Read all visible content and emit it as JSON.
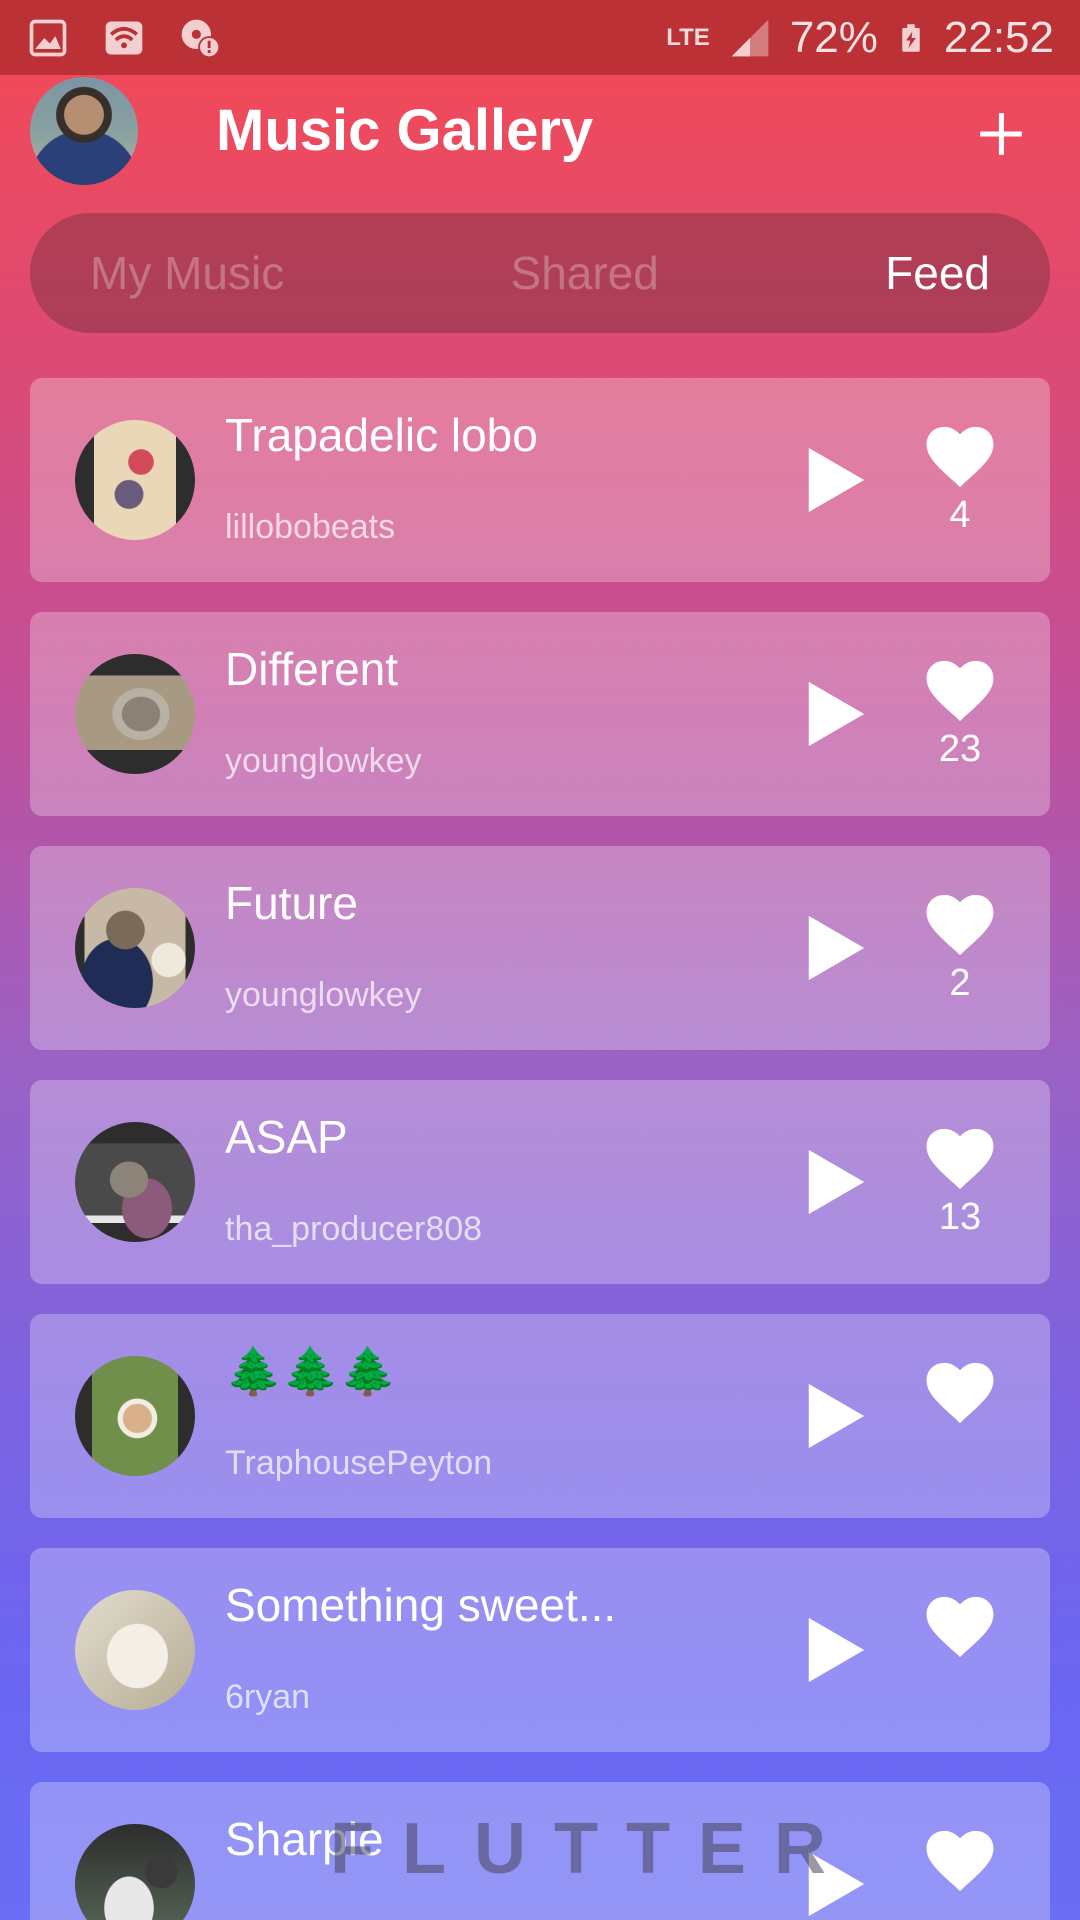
{
  "status_bar": {
    "battery": "72%",
    "time": "22:52",
    "network": "LTE"
  },
  "header": {
    "title": "Music Gallery",
    "add_icon": "plus-icon"
  },
  "tabs": [
    {
      "label": "My Music",
      "active": false
    },
    {
      "label": "Shared",
      "active": false
    },
    {
      "label": "Feed",
      "active": true
    }
  ],
  "tracks": [
    {
      "title": "Trapadelic lobo",
      "artist": "lillobobeats",
      "likes": "4"
    },
    {
      "title": "Different",
      "artist": "younglowkey",
      "likes": "23"
    },
    {
      "title": "Future",
      "artist": "younglowkey",
      "likes": "2"
    },
    {
      "title": "ASAP",
      "artist": "tha_producer808",
      "likes": "13"
    },
    {
      "title": "🌲🌲🌲",
      "artist": "TraphousePeyton",
      "likes": ""
    },
    {
      "title": "Something sweet...",
      "artist": "6ryan",
      "likes": ""
    },
    {
      "title": "Sharpie",
      "artist": "",
      "likes": ""
    }
  ],
  "watermark": "FLUTTER",
  "colors": {
    "status_bar": "#bb3136",
    "gradient_top": "#f64a52",
    "gradient_bottom": "#6a6ef4"
  }
}
